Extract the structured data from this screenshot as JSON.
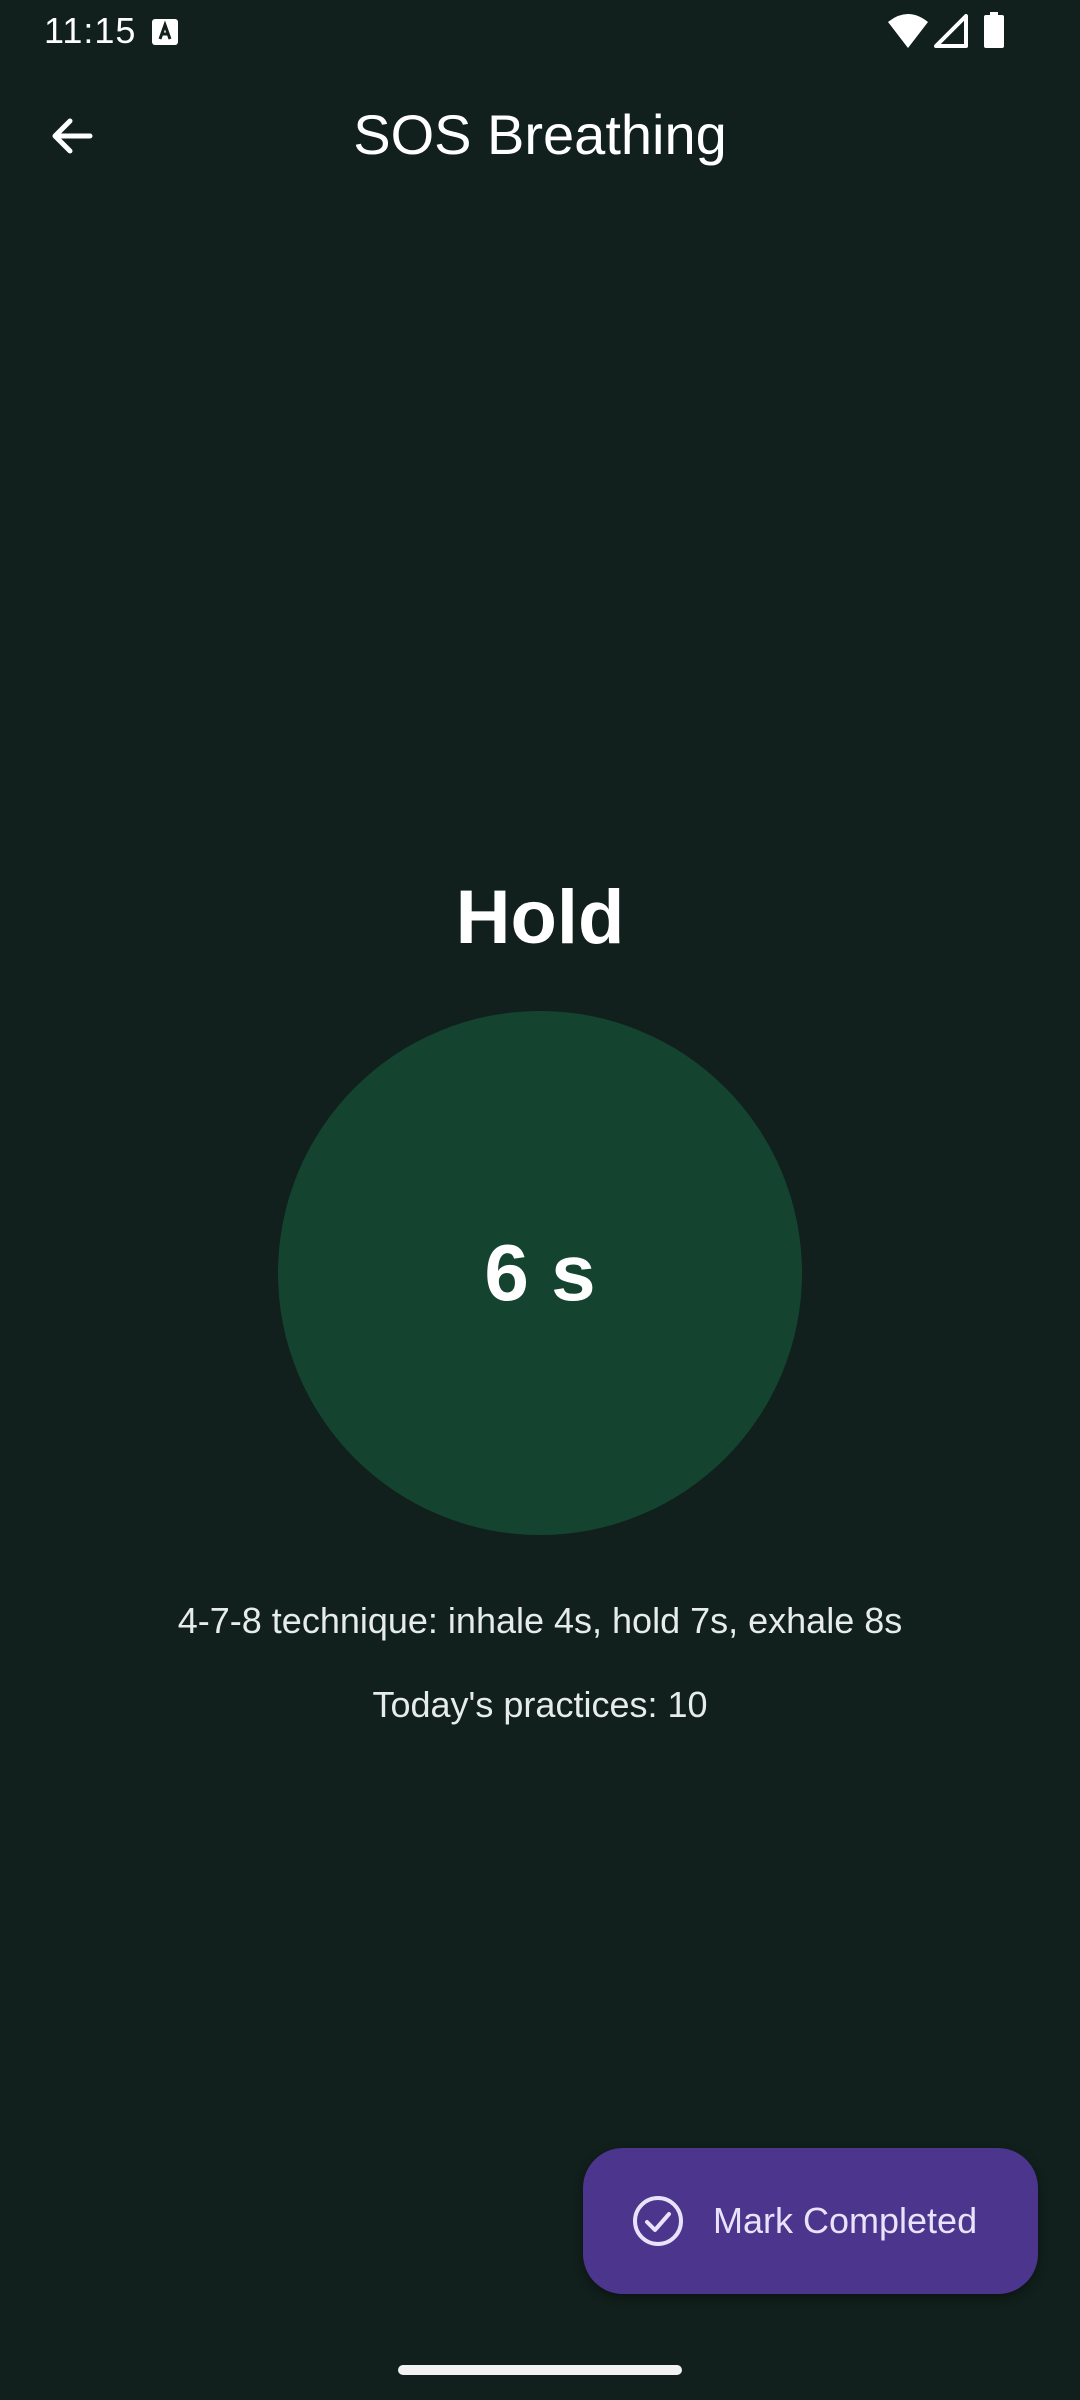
{
  "status_bar": {
    "time": "11:15",
    "icons": [
      "text-a-icon",
      "wifi-icon",
      "cell-signal-icon",
      "battery-icon"
    ]
  },
  "app_bar": {
    "title": "SOS Breathing",
    "back_icon": "arrow-back-icon"
  },
  "exercise": {
    "phase": "Hold",
    "countdown": "6 s",
    "technique": "4-7-8 technique: inhale 4s, hold 7s, exhale 8s",
    "practices": "Today's practices: 10"
  },
  "fab": {
    "label": "Mark Completed",
    "icon": "check-circle-icon"
  },
  "colors": {
    "background": "#11201c",
    "circle": "#144430",
    "fab": "#4c358c",
    "fab_text": "#e9e2fb"
  }
}
